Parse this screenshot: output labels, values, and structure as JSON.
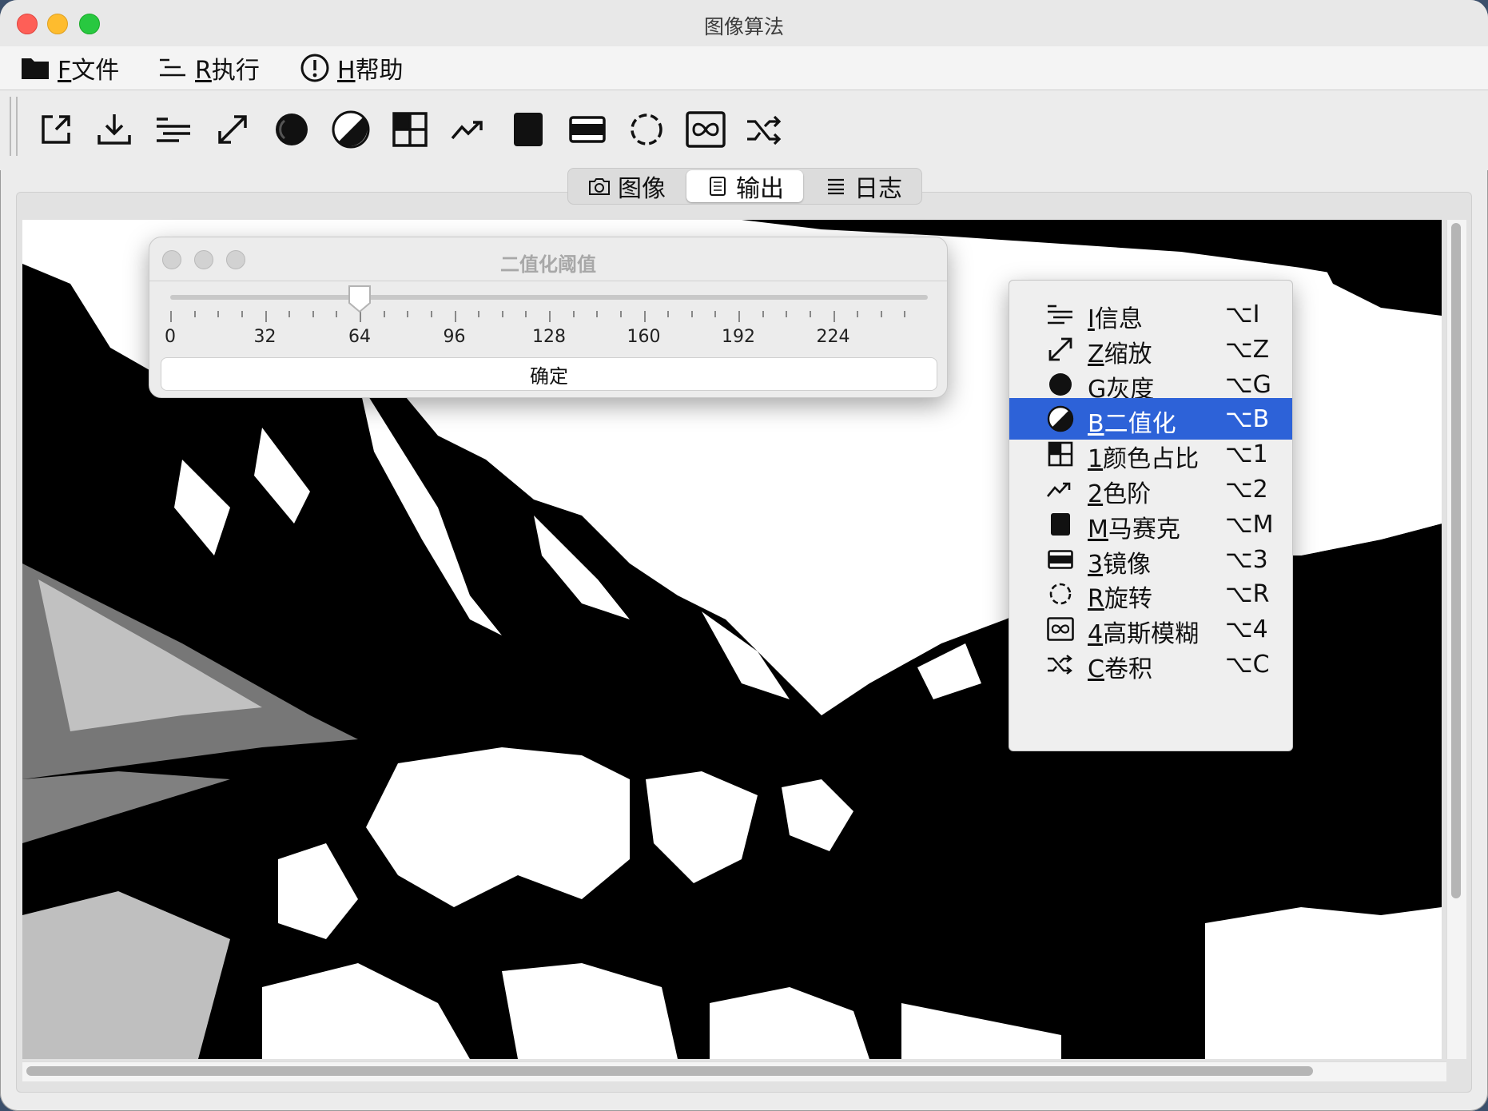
{
  "window": {
    "title": "图像算法"
  },
  "menubar": {
    "items": [
      {
        "mnemonic": "F",
        "label": "文件",
        "icon": "folder-icon"
      },
      {
        "mnemonic": "R",
        "label": "执行",
        "icon": "list-icon"
      },
      {
        "mnemonic": "H",
        "label": "帮助",
        "icon": "info-circle-icon"
      }
    ]
  },
  "toolbar": {
    "buttons": [
      "export-icon",
      "download-icon",
      "info-list-icon",
      "resize-icon",
      "grayscale-icon",
      "binarize-icon",
      "color-ratio-icon",
      "levels-icon",
      "mosaic-icon",
      "mirror-icon",
      "rotate-icon",
      "gaussian-blur-icon",
      "convolution-icon"
    ]
  },
  "tabs": [
    {
      "label": "图像",
      "icon": "camera-icon"
    },
    {
      "label": "输出",
      "icon": "document-icon",
      "active": true
    },
    {
      "label": "日志",
      "icon": "lines-icon"
    }
  ],
  "dialog": {
    "title": "二值化阈值",
    "slider_value": 64,
    "slider_min": 0,
    "slider_max": 255,
    "tick_labels": [
      "0",
      "32",
      "64",
      "96",
      "128",
      "160",
      "192",
      "224"
    ],
    "ok_label": "确定"
  },
  "context_menu": {
    "items": [
      {
        "mnemonic": "I",
        "label": "信息",
        "shortcut": "⌥I",
        "icon": "info-list-icon"
      },
      {
        "mnemonic": "Z",
        "label": "缩放",
        "shortcut": "⌥Z",
        "icon": "resize-icon"
      },
      {
        "mnemonic": "G",
        "label": "灰度",
        "shortcut": "⌥G",
        "icon": "grayscale-icon"
      },
      {
        "mnemonic": "B",
        "label": "二值化",
        "shortcut": "⌥B",
        "icon": "binarize-icon",
        "selected": true
      },
      {
        "mnemonic": "1",
        "label": "颜色占比",
        "shortcut": "⌥1",
        "icon": "color-ratio-icon"
      },
      {
        "mnemonic": "2",
        "label": "色阶",
        "shortcut": "⌥2",
        "icon": "levels-icon"
      },
      {
        "mnemonic": "M",
        "label": "马赛克",
        "shortcut": "⌥M",
        "icon": "mosaic-icon"
      },
      {
        "mnemonic": "3",
        "label": "镜像",
        "shortcut": "⌥3",
        "icon": "mirror-icon"
      },
      {
        "mnemonic": "R",
        "label": "旋转",
        "shortcut": "⌥R",
        "icon": "rotate-icon"
      },
      {
        "mnemonic": "4",
        "label": "高斯模糊",
        "shortcut": "⌥4",
        "icon": "gaussian-blur-icon"
      },
      {
        "mnemonic": "C",
        "label": "卷积",
        "shortcut": "⌥C",
        "icon": "convolution-icon"
      }
    ]
  },
  "colors": {
    "selection": "#2d62d8",
    "image_dark": "#000000",
    "image_light": "#ffffff"
  }
}
